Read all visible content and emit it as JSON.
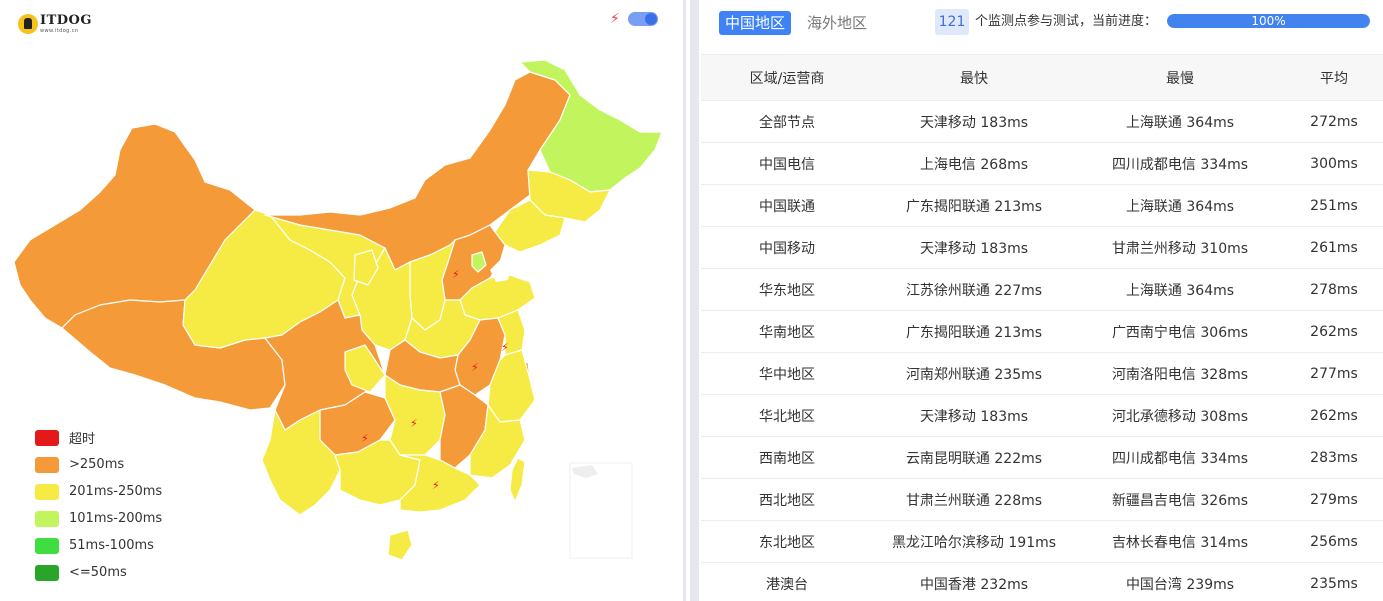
{
  "logo": {
    "name": "ITDOG",
    "url": "www.itdog.cn"
  },
  "map_legend": [
    {
      "label": "超时",
      "color": "#e41a1a"
    },
    {
      "label": ">250ms",
      "color": "#f59a38"
    },
    {
      "label": "201ms-250ms",
      "color": "#f6eb45"
    },
    {
      "label": "101ms-200ms",
      "color": "#c2f45e"
    },
    {
      "label": "51ms-100ms",
      "color": "#40dd40"
    },
    {
      "label": "<=50ms",
      "color": "#2aa52a"
    }
  ],
  "tabs": {
    "domestic": "中国地区",
    "overseas": "海外地区"
  },
  "summary": {
    "count": "121",
    "text": "个监测点参与测试，当前进度：",
    "progress_text": "100%",
    "progress_value": 100
  },
  "table": {
    "headers": [
      "区域/运营商",
      "最快",
      "最慢",
      "平均"
    ],
    "rows": [
      [
        "全部节点",
        "天津移动 183ms",
        "上海联通 364ms",
        "272ms"
      ],
      [
        "中国电信",
        "上海电信 268ms",
        "四川成都电信 334ms",
        "300ms"
      ],
      [
        "中国联通",
        "广东揭阳联通 213ms",
        "上海联通 364ms",
        "251ms"
      ],
      [
        "中国移动",
        "天津移动 183ms",
        "甘肃兰州移动 310ms",
        "261ms"
      ],
      [
        "华东地区",
        "江苏徐州联通 227ms",
        "上海联通 364ms",
        "278ms"
      ],
      [
        "华南地区",
        "广东揭阳联通 213ms",
        "广西南宁电信 306ms",
        "262ms"
      ],
      [
        "华中地区",
        "河南郑州联通 235ms",
        "河南洛阳电信 328ms",
        "277ms"
      ],
      [
        "华北地区",
        "天津移动 183ms",
        "河北承德移动 308ms",
        "262ms"
      ],
      [
        "西南地区",
        "云南昆明联通 222ms",
        "四川成都电信 334ms",
        "283ms"
      ],
      [
        "西北地区",
        "甘肃兰州联通 228ms",
        "新疆昌吉电信 326ms",
        "279ms"
      ],
      [
        "东北地区",
        "黑龙江哈尔滨移动 191ms",
        "吉林长春电信 314ms",
        "256ms"
      ],
      [
        "港澳台",
        "中国香港 232ms",
        "中国台湾 239ms",
        "235ms"
      ]
    ]
  },
  "icons": {
    "bolt": "lightning-icon",
    "toggle": "toggle-switch"
  }
}
